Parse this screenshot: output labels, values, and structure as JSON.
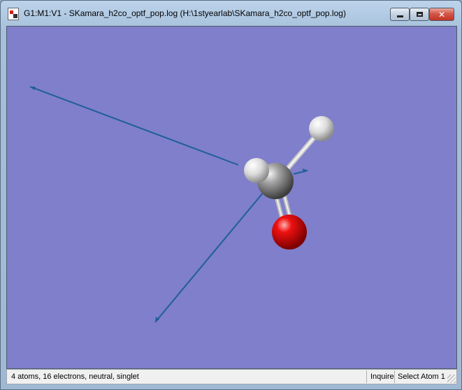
{
  "window": {
    "title": "G1:M1:V1 - SKamara_h2co_optf_pop.log (H:\\1styearlab\\SKamara_h2co_optf_pop.log)",
    "close_glyph": "✕"
  },
  "viewport": {
    "background": "#7f7fcb",
    "vector_color": "#1f5f96",
    "atoms": [
      {
        "element": "C",
        "color": "#8f8f8f"
      },
      {
        "element": "O",
        "color": "#e0000a"
      },
      {
        "element": "H",
        "color": "#e2e2e2"
      },
      {
        "element": "H",
        "color": "#e2e2e2"
      }
    ]
  },
  "statusbar": {
    "info": "4 atoms, 16 electrons, neutral, singlet",
    "mode": "Inquire",
    "select": "Select Atom 1"
  }
}
